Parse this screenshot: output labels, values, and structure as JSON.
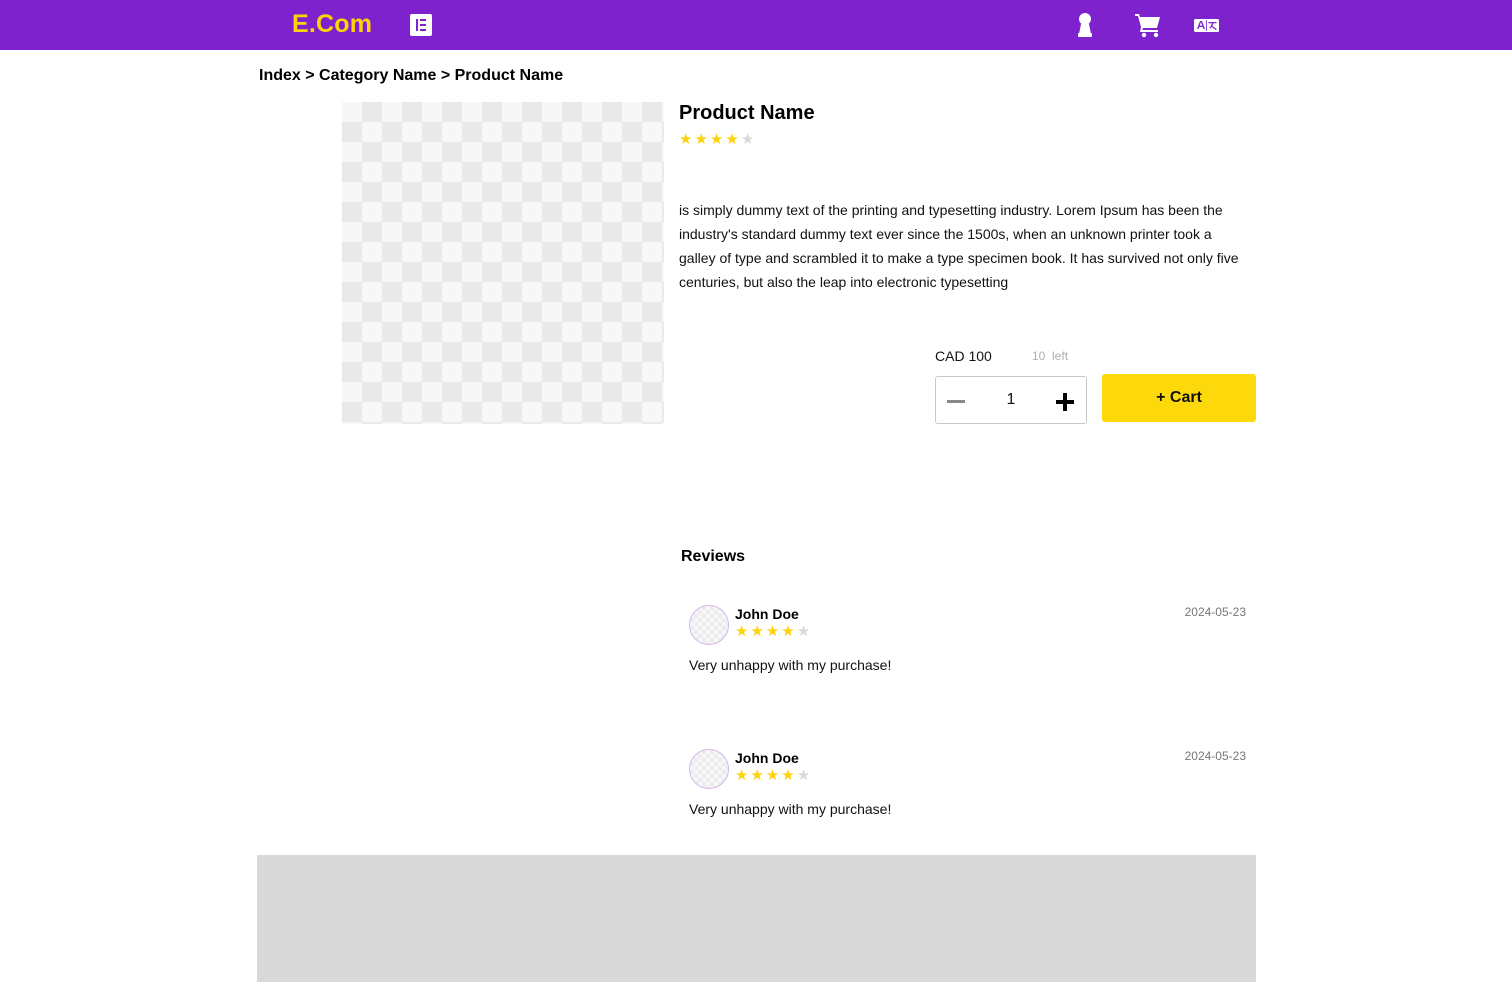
{
  "header": {
    "logo": "E.Com",
    "brand_color": "#7e22ce",
    "accent_color": "#fdd20a",
    "icons": [
      "menu-icon",
      "user-icon",
      "cart-icon",
      "translate-icon"
    ]
  },
  "breadcrumb": {
    "text": "Index > Category Name > Product Name"
  },
  "product": {
    "name": "Product Name",
    "rating": 4,
    "rating_max": 5,
    "description": "is simply dummy text of the printing and typesetting industry. Lorem Ipsum has been the industry's standard dummy text ever since the 1500s, when an unknown printer took a galley of type and scrambled it to make a type specimen book. It has survived not only five centuries, but also the leap into electronic typesetting",
    "price": "CAD 100",
    "stock": "10  left",
    "quantity": "1",
    "add_to_cart_label": "+ Cart"
  },
  "reviews": {
    "title": "Reviews",
    "items": [
      {
        "author": "John Doe",
        "rating": 4,
        "date": "2024-05-23",
        "text": "Very unhappy with my purchase!"
      },
      {
        "author": "John Doe",
        "rating": 4,
        "date": "2024-05-23",
        "text": "Very unhappy with my purchase!"
      }
    ]
  }
}
